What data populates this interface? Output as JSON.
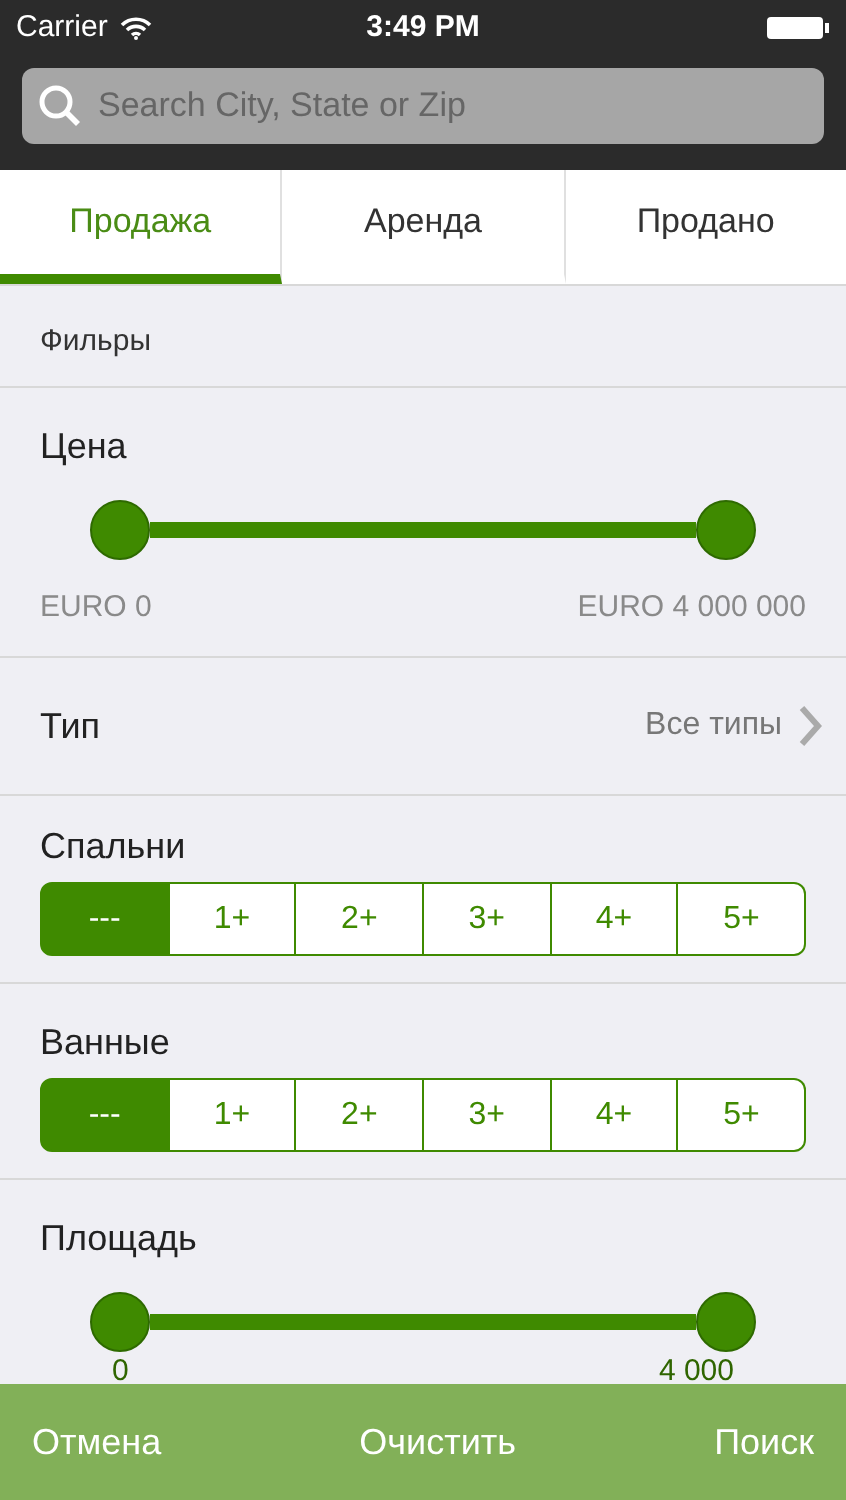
{
  "status_bar": {
    "carrier": "Carrier",
    "time": "3:49 PM"
  },
  "search": {
    "placeholder": "Search City, State or Zip"
  },
  "tabs": [
    {
      "label": "Продажа",
      "selected": true
    },
    {
      "label": "Аренда",
      "selected": false
    },
    {
      "label": "Продано",
      "selected": false
    }
  ],
  "filters_header": "Фильры",
  "price": {
    "label": "Цена",
    "level": 1,
    "min": "EURO 0",
    "max": "EURO 4 000 000"
  },
  "type": {
    "label": "Тип",
    "value": "Все типы"
  },
  "bedrooms": {
    "label": "Спальни",
    "options": [
      {
        "label": "---",
        "selected": true
      },
      {
        "label": "1+",
        "selected": false
      },
      {
        "label": "2+",
        "selected": false
      },
      {
        "label": "3+",
        "selected": false
      },
      {
        "label": "4+",
        "selected": false
      },
      {
        "label": "5+",
        "selected": false
      }
    ]
  },
  "bathrooms": {
    "label": "Ванные",
    "options": [
      {
        "label": "---",
        "selected": true
      },
      {
        "label": "1+",
        "selected": false
      },
      {
        "label": "2+",
        "selected": false
      },
      {
        "label": "3+",
        "selected": false
      },
      {
        "label": "4+",
        "selected": false
      },
      {
        "label": "5+",
        "selected": false
      }
    ]
  },
  "area": {
    "label": "Площадь",
    "level": 1,
    "min": "0",
    "max": "4 000"
  },
  "bottom_bar": {
    "cancel": "Отмена",
    "clear": "Очистить",
    "search": "Поиск"
  }
}
